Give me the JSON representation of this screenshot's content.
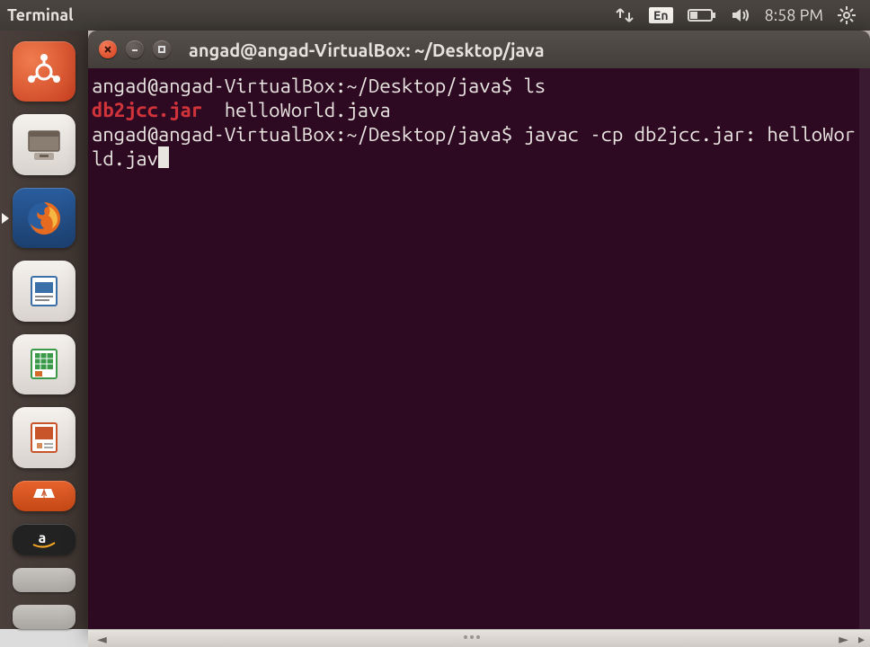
{
  "menubar": {
    "app_label": "Terminal",
    "language": "En",
    "clock": "8:58 PM"
  },
  "launcher": {
    "items": [
      {
        "name": "dash"
      },
      {
        "name": "files"
      },
      {
        "name": "firefox"
      },
      {
        "name": "writer"
      },
      {
        "name": "calc"
      },
      {
        "name": "impress"
      },
      {
        "name": "software-center"
      },
      {
        "name": "amazon"
      }
    ]
  },
  "window": {
    "title": "angad@angad-VirtualBox: ~/Desktop/java"
  },
  "terminal": {
    "lines": {
      "prompt1": "angad@angad-VirtualBox:~/Desktop/java$ ",
      "cmd1": "ls",
      "out_red": "db2jcc.jar",
      "out_gap": "  ",
      "out_plain": "helloWorld.java",
      "prompt2": "angad@angad-VirtualBox:~/Desktop/java$ ",
      "cmd2": "javac -cp db2jcc.jar: helloWorld.jav"
    }
  }
}
